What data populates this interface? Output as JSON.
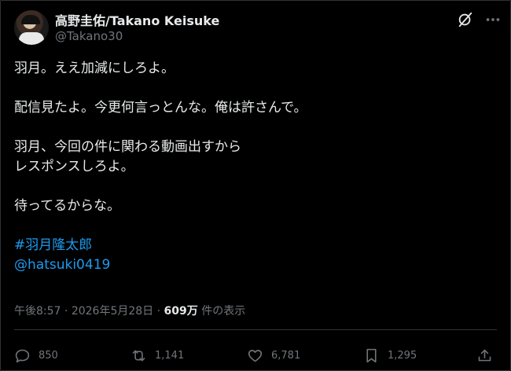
{
  "user": {
    "display_name": "高野圭佑/Takano Keisuke",
    "handle": "@Takano30"
  },
  "post": {
    "lines": [
      "羽月。ええ加減にしろよ。",
      "",
      "配信見たよ。今更何言っとんな。俺は許さんで。",
      "",
      "羽月、今回の件に関わる動画出すから",
      "レスポンスしろよ。",
      "",
      "待ってるからな。",
      ""
    ],
    "hashtag": "#羽月隆太郎",
    "mention": "@hatsuki0419"
  },
  "meta": {
    "time": "午後8:57",
    "date": "2026年5月28日",
    "separator": "·",
    "views_count": "609万",
    "views_label": "件の表示"
  },
  "actions": {
    "replies": "850",
    "reposts": "1,141",
    "likes": "6,781",
    "bookmarks": "1,295"
  },
  "icons": [
    "grok-icon",
    "more-icon",
    "reply-icon",
    "repost-icon",
    "like-icon",
    "bookmark-icon",
    "share-icon"
  ],
  "colors": {
    "background": "#000000",
    "text": "#e7e9ea",
    "secondary": "#71767b",
    "link": "#1d9bf0",
    "divider": "#2f3336"
  }
}
